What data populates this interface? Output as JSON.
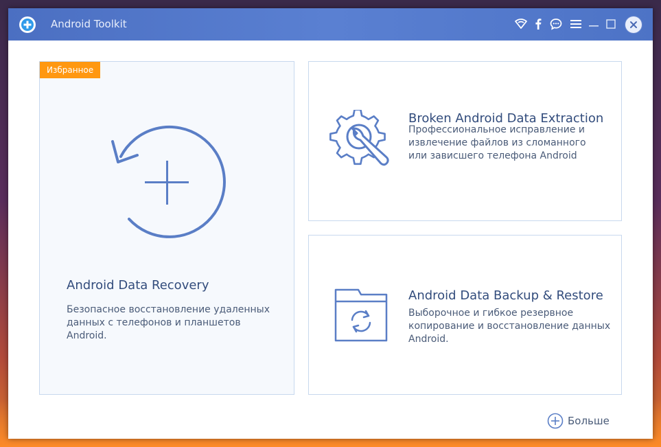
{
  "window": {
    "title": "Android Toolkit",
    "controls": [
      "wifi-icon",
      "facebook-icon",
      "chat-icon",
      "menu-icon",
      "minimize-icon",
      "maximize-icon",
      "close-icon"
    ]
  },
  "cards": {
    "recovery": {
      "badge": "Избранное",
      "title": "Android Data Recovery",
      "description": "Безопасное восстановление удаленных данных с телефонов и планшетов Android.",
      "icon": "restore-plus-icon"
    },
    "extraction": {
      "title": "Broken Android Data Extraction",
      "description": "Профессиональное исправление и извлечение файлов из сломанного или зависшего телефона Android",
      "icon": "gear-wrench-icon"
    },
    "backup": {
      "title": "Android Data Backup & Restore",
      "description": "Выборочное и гибкое резервное копирование и восстановление данных Android.",
      "icon": "folder-sync-icon"
    }
  },
  "footer": {
    "more_label": "Больше"
  },
  "colors": {
    "titlebar": "#4f74c7",
    "accent": "#5a7ec6",
    "badge": "#ff9810",
    "border": "#c7d8ee"
  }
}
